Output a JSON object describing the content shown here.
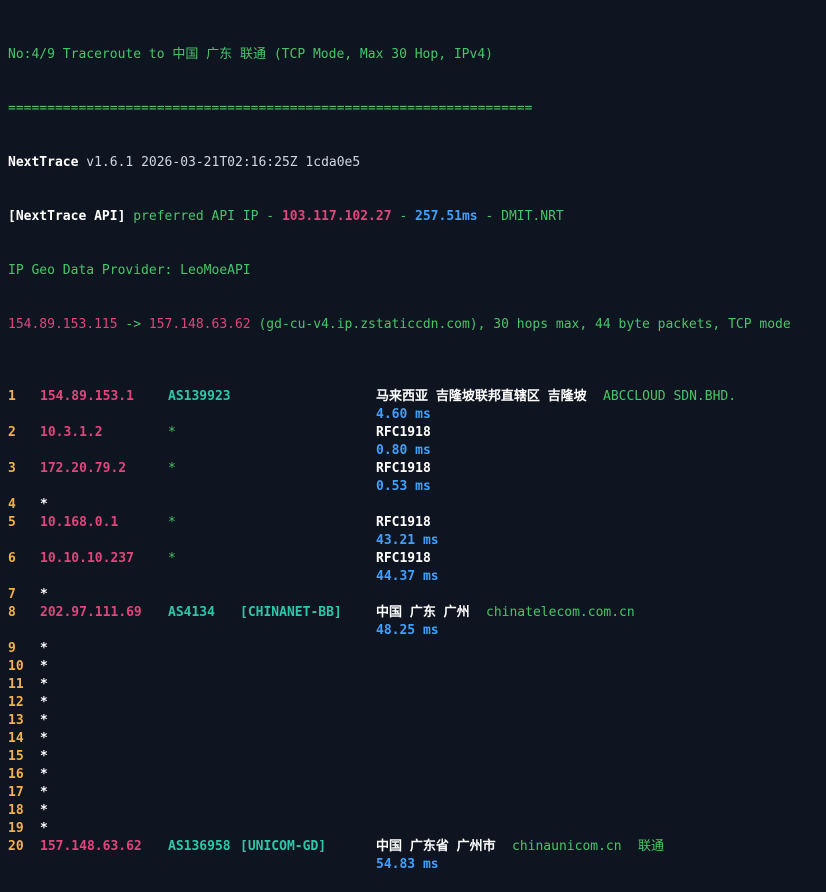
{
  "header": {
    "line1": "No:4/9 Traceroute to 中国 广东 联通 (TCP Mode, Max 30 Hop, IPv4)",
    "separator": "===================================================================",
    "app_name": "NextTrace",
    "app_version": " v1.6.1 2026-03-21T02:16:25Z 1cda0e5",
    "api_label": "[NextTrace API]",
    "api_text": " preferred API IP - ",
    "api_ip": "103.117.102.27",
    "api_dash": " - ",
    "api_latency": "257.51ms",
    "api_node": " - DMIT.NRT",
    "geo_provider": "IP Geo Data Provider: LeoMoeAPI",
    "route_src": "154.89.153.115",
    "route_arrow": " -> ",
    "route_dst": "157.148.63.62",
    "route_info": " (gd-cu-v4.ip.zstaticcdn.com), 30 hops max, 44 byte packets, TCP mode"
  },
  "hops": [
    {
      "num": "1",
      "ip": "154.89.153.1",
      "asn": "AS139923",
      "tag": "",
      "geo": "马来西亚 吉隆坡联邦直辖区 吉隆坡",
      "org": "ABCCLOUD SDN.BHD.",
      "org_extra": "",
      "latency": "4.60 ms"
    },
    {
      "num": "2",
      "ip": "10.3.1.2",
      "asn": "*",
      "tag": "",
      "geo": "RFC1918",
      "org": "",
      "org_extra": "",
      "latency": "0.80 ms"
    },
    {
      "num": "3",
      "ip": "172.20.79.2",
      "asn": "*",
      "tag": "",
      "geo": "RFC1918",
      "org": "",
      "org_extra": "",
      "latency": "0.53 ms"
    },
    {
      "num": "4",
      "ip": "*",
      "asn": "",
      "tag": "",
      "geo": "",
      "org": "",
      "org_extra": "",
      "latency": ""
    },
    {
      "num": "5",
      "ip": "10.168.0.1",
      "asn": "*",
      "tag": "",
      "geo": "RFC1918",
      "org": "",
      "org_extra": "",
      "latency": "43.21 ms"
    },
    {
      "num": "6",
      "ip": "10.10.10.237",
      "asn": "*",
      "tag": "",
      "geo": "RFC1918",
      "org": "",
      "org_extra": "",
      "latency": "44.37 ms"
    },
    {
      "num": "7",
      "ip": "*",
      "asn": "",
      "tag": "",
      "geo": "",
      "org": "",
      "org_extra": "",
      "latency": ""
    },
    {
      "num": "8",
      "ip": "202.97.111.69",
      "asn": "AS4134",
      "tag": "[CHINANET-BB]",
      "geo": "中国 广东 广州",
      "org": "chinatelecom.com.cn",
      "org_extra": "",
      "latency": "48.25 ms"
    },
    {
      "num": "9",
      "ip": "*",
      "asn": "",
      "tag": "",
      "geo": "",
      "org": "",
      "org_extra": "",
      "latency": ""
    },
    {
      "num": "10",
      "ip": "*",
      "asn": "",
      "tag": "",
      "geo": "",
      "org": "",
      "org_extra": "",
      "latency": ""
    },
    {
      "num": "11",
      "ip": "*",
      "asn": "",
      "tag": "",
      "geo": "",
      "org": "",
      "org_extra": "",
      "latency": ""
    },
    {
      "num": "12",
      "ip": "*",
      "asn": "",
      "tag": "",
      "geo": "",
      "org": "",
      "org_extra": "",
      "latency": ""
    },
    {
      "num": "13",
      "ip": "*",
      "asn": "",
      "tag": "",
      "geo": "",
      "org": "",
      "org_extra": "",
      "latency": ""
    },
    {
      "num": "14",
      "ip": "*",
      "asn": "",
      "tag": "",
      "geo": "",
      "org": "",
      "org_extra": "",
      "latency": ""
    },
    {
      "num": "15",
      "ip": "*",
      "asn": "",
      "tag": "",
      "geo": "",
      "org": "",
      "org_extra": "",
      "latency": ""
    },
    {
      "num": "16",
      "ip": "*",
      "asn": "",
      "tag": "",
      "geo": "",
      "org": "",
      "org_extra": "",
      "latency": ""
    },
    {
      "num": "17",
      "ip": "*",
      "asn": "",
      "tag": "",
      "geo": "",
      "org": "",
      "org_extra": "",
      "latency": ""
    },
    {
      "num": "18",
      "ip": "*",
      "asn": "",
      "tag": "",
      "geo": "",
      "org": "",
      "org_extra": "",
      "latency": ""
    },
    {
      "num": "19",
      "ip": "*",
      "asn": "",
      "tag": "",
      "geo": "",
      "org": "",
      "org_extra": "",
      "latency": ""
    },
    {
      "num": "20",
      "ip": "157.148.63.62",
      "asn": "AS136958",
      "tag": "[UNICOM-GD]",
      "geo": "中国 广东省 广州市",
      "org": "chinaunicom.cn",
      "org_extra": "联通",
      "latency": "54.83 ms"
    }
  ],
  "colors": {
    "background": "#0f1520",
    "green": "#47c46a",
    "pink": "#e0457b",
    "blue": "#3fa0ff",
    "orange": "#f4b04a",
    "teal": "#2cc7a8"
  }
}
